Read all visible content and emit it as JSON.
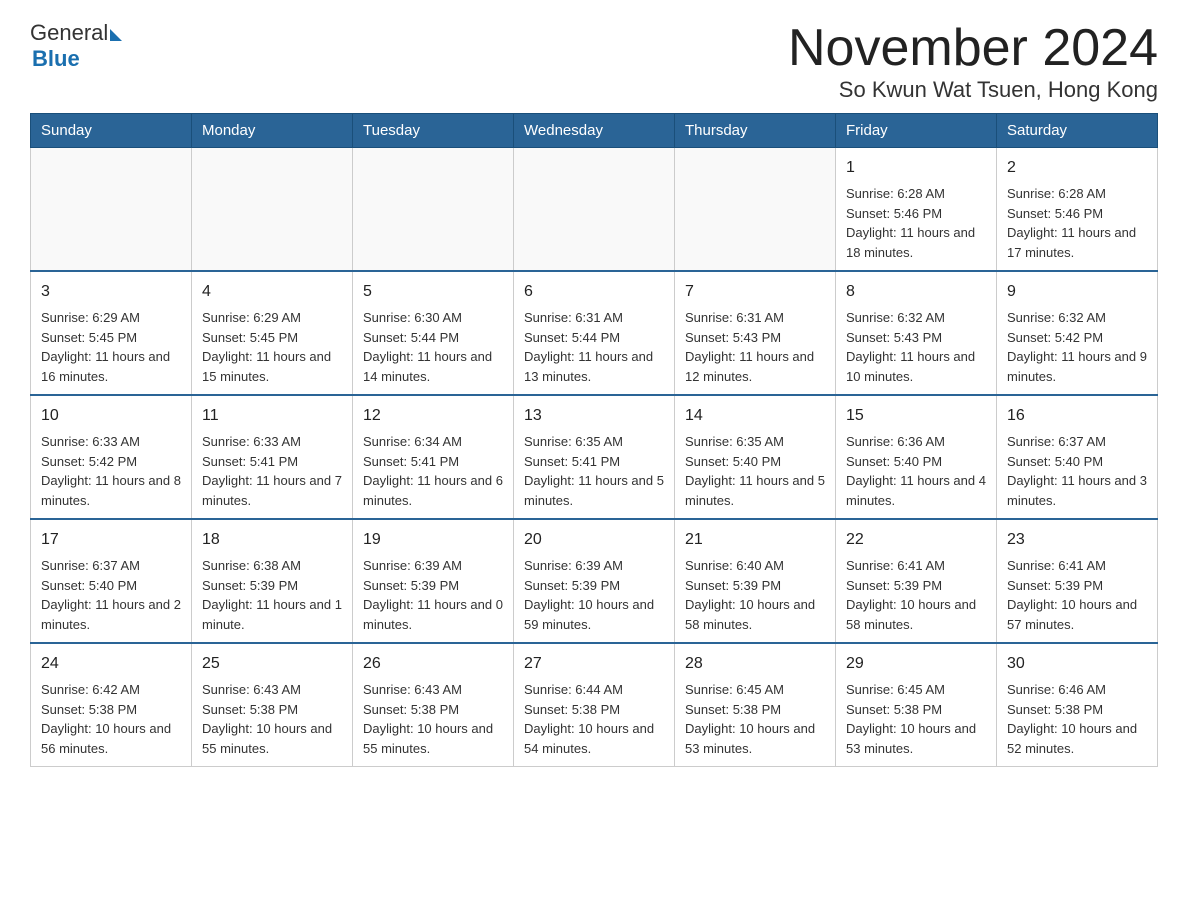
{
  "header": {
    "logo": {
      "general": "General",
      "blue": "Blue"
    },
    "title": "November 2024",
    "location": "So Kwun Wat Tsuen, Hong Kong"
  },
  "days_of_week": [
    "Sunday",
    "Monday",
    "Tuesday",
    "Wednesday",
    "Thursday",
    "Friday",
    "Saturday"
  ],
  "weeks": [
    {
      "days": [
        {
          "number": "",
          "info": ""
        },
        {
          "number": "",
          "info": ""
        },
        {
          "number": "",
          "info": ""
        },
        {
          "number": "",
          "info": ""
        },
        {
          "number": "",
          "info": ""
        },
        {
          "number": "1",
          "info": "Sunrise: 6:28 AM\nSunset: 5:46 PM\nDaylight: 11 hours and 18 minutes."
        },
        {
          "number": "2",
          "info": "Sunrise: 6:28 AM\nSunset: 5:46 PM\nDaylight: 11 hours and 17 minutes."
        }
      ]
    },
    {
      "days": [
        {
          "number": "3",
          "info": "Sunrise: 6:29 AM\nSunset: 5:45 PM\nDaylight: 11 hours and 16 minutes."
        },
        {
          "number": "4",
          "info": "Sunrise: 6:29 AM\nSunset: 5:45 PM\nDaylight: 11 hours and 15 minutes."
        },
        {
          "number": "5",
          "info": "Sunrise: 6:30 AM\nSunset: 5:44 PM\nDaylight: 11 hours and 14 minutes."
        },
        {
          "number": "6",
          "info": "Sunrise: 6:31 AM\nSunset: 5:44 PM\nDaylight: 11 hours and 13 minutes."
        },
        {
          "number": "7",
          "info": "Sunrise: 6:31 AM\nSunset: 5:43 PM\nDaylight: 11 hours and 12 minutes."
        },
        {
          "number": "8",
          "info": "Sunrise: 6:32 AM\nSunset: 5:43 PM\nDaylight: 11 hours and 10 minutes."
        },
        {
          "number": "9",
          "info": "Sunrise: 6:32 AM\nSunset: 5:42 PM\nDaylight: 11 hours and 9 minutes."
        }
      ]
    },
    {
      "days": [
        {
          "number": "10",
          "info": "Sunrise: 6:33 AM\nSunset: 5:42 PM\nDaylight: 11 hours and 8 minutes."
        },
        {
          "number": "11",
          "info": "Sunrise: 6:33 AM\nSunset: 5:41 PM\nDaylight: 11 hours and 7 minutes."
        },
        {
          "number": "12",
          "info": "Sunrise: 6:34 AM\nSunset: 5:41 PM\nDaylight: 11 hours and 6 minutes."
        },
        {
          "number": "13",
          "info": "Sunrise: 6:35 AM\nSunset: 5:41 PM\nDaylight: 11 hours and 5 minutes."
        },
        {
          "number": "14",
          "info": "Sunrise: 6:35 AM\nSunset: 5:40 PM\nDaylight: 11 hours and 5 minutes."
        },
        {
          "number": "15",
          "info": "Sunrise: 6:36 AM\nSunset: 5:40 PM\nDaylight: 11 hours and 4 minutes."
        },
        {
          "number": "16",
          "info": "Sunrise: 6:37 AM\nSunset: 5:40 PM\nDaylight: 11 hours and 3 minutes."
        }
      ]
    },
    {
      "days": [
        {
          "number": "17",
          "info": "Sunrise: 6:37 AM\nSunset: 5:40 PM\nDaylight: 11 hours and 2 minutes."
        },
        {
          "number": "18",
          "info": "Sunrise: 6:38 AM\nSunset: 5:39 PM\nDaylight: 11 hours and 1 minute."
        },
        {
          "number": "19",
          "info": "Sunrise: 6:39 AM\nSunset: 5:39 PM\nDaylight: 11 hours and 0 minutes."
        },
        {
          "number": "20",
          "info": "Sunrise: 6:39 AM\nSunset: 5:39 PM\nDaylight: 10 hours and 59 minutes."
        },
        {
          "number": "21",
          "info": "Sunrise: 6:40 AM\nSunset: 5:39 PM\nDaylight: 10 hours and 58 minutes."
        },
        {
          "number": "22",
          "info": "Sunrise: 6:41 AM\nSunset: 5:39 PM\nDaylight: 10 hours and 58 minutes."
        },
        {
          "number": "23",
          "info": "Sunrise: 6:41 AM\nSunset: 5:39 PM\nDaylight: 10 hours and 57 minutes."
        }
      ]
    },
    {
      "days": [
        {
          "number": "24",
          "info": "Sunrise: 6:42 AM\nSunset: 5:38 PM\nDaylight: 10 hours and 56 minutes."
        },
        {
          "number": "25",
          "info": "Sunrise: 6:43 AM\nSunset: 5:38 PM\nDaylight: 10 hours and 55 minutes."
        },
        {
          "number": "26",
          "info": "Sunrise: 6:43 AM\nSunset: 5:38 PM\nDaylight: 10 hours and 55 minutes."
        },
        {
          "number": "27",
          "info": "Sunrise: 6:44 AM\nSunset: 5:38 PM\nDaylight: 10 hours and 54 minutes."
        },
        {
          "number": "28",
          "info": "Sunrise: 6:45 AM\nSunset: 5:38 PM\nDaylight: 10 hours and 53 minutes."
        },
        {
          "number": "29",
          "info": "Sunrise: 6:45 AM\nSunset: 5:38 PM\nDaylight: 10 hours and 53 minutes."
        },
        {
          "number": "30",
          "info": "Sunrise: 6:46 AM\nSunset: 5:38 PM\nDaylight: 10 hours and 52 minutes."
        }
      ]
    }
  ]
}
